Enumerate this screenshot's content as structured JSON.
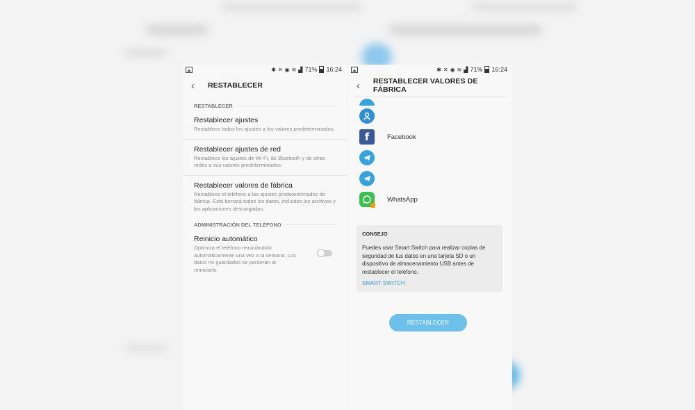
{
  "status": {
    "battery": "71%",
    "time": "16:24"
  },
  "left": {
    "title": "RESTABLECER",
    "section1": "RESTABLECER",
    "items": [
      {
        "title": "Restablecer ajustes",
        "desc": "Restablece todos los ajustes a los valores predeterminados."
      },
      {
        "title": "Restablecer ajustes de red",
        "desc": "Restablece los ajustes de Wi-Fi, de Bluetooth y de otras redes a sus valores predeterminados."
      },
      {
        "title": "Restablecer valores de fábrica",
        "desc": "Restablece el teléfono a los ajustes predeterminados de fábrica. Esto borrará todos los datos, incluidos los archivos y las aplicaciones descargadas."
      }
    ],
    "section2": "ADMINISTRACIÓN DEL TELÉFONO",
    "auto_restart": {
      "title": "Reinicio automático",
      "desc": "Optimiza el teléfono reiniciándolo automáticamente una vez a la semana. Los datos no guardados se perderán al reiniciarlo.",
      "enabled": false
    }
  },
  "right": {
    "title": "RESTABLECER VALORES DE FÁBRICA",
    "apps": [
      {
        "icon": "account-icon",
        "name": ""
      },
      {
        "icon": "facebook-icon",
        "name": "Facebook"
      },
      {
        "icon": "telegram-icon",
        "name": ""
      },
      {
        "icon": "telegram-icon",
        "name": ""
      },
      {
        "icon": "whatsapp-icon",
        "name": "WhatsApp"
      }
    ],
    "consejo": {
      "title": "CONSEJO",
      "text": "Puedes usar Smart Switch para realizar copias de seguridad de tus datos en una tarjeta SD o un dispositivo de almacenamiento USB antes de restablecer el teléfono.",
      "link": "SMART SWITCH"
    },
    "button": "RESTABLECER"
  },
  "colors": {
    "accent": "#3a9fd8",
    "button": "#6cc0ea",
    "facebook": "#3b5998",
    "telegram": "#36a3dc",
    "whatsapp": "#3cc151"
  }
}
